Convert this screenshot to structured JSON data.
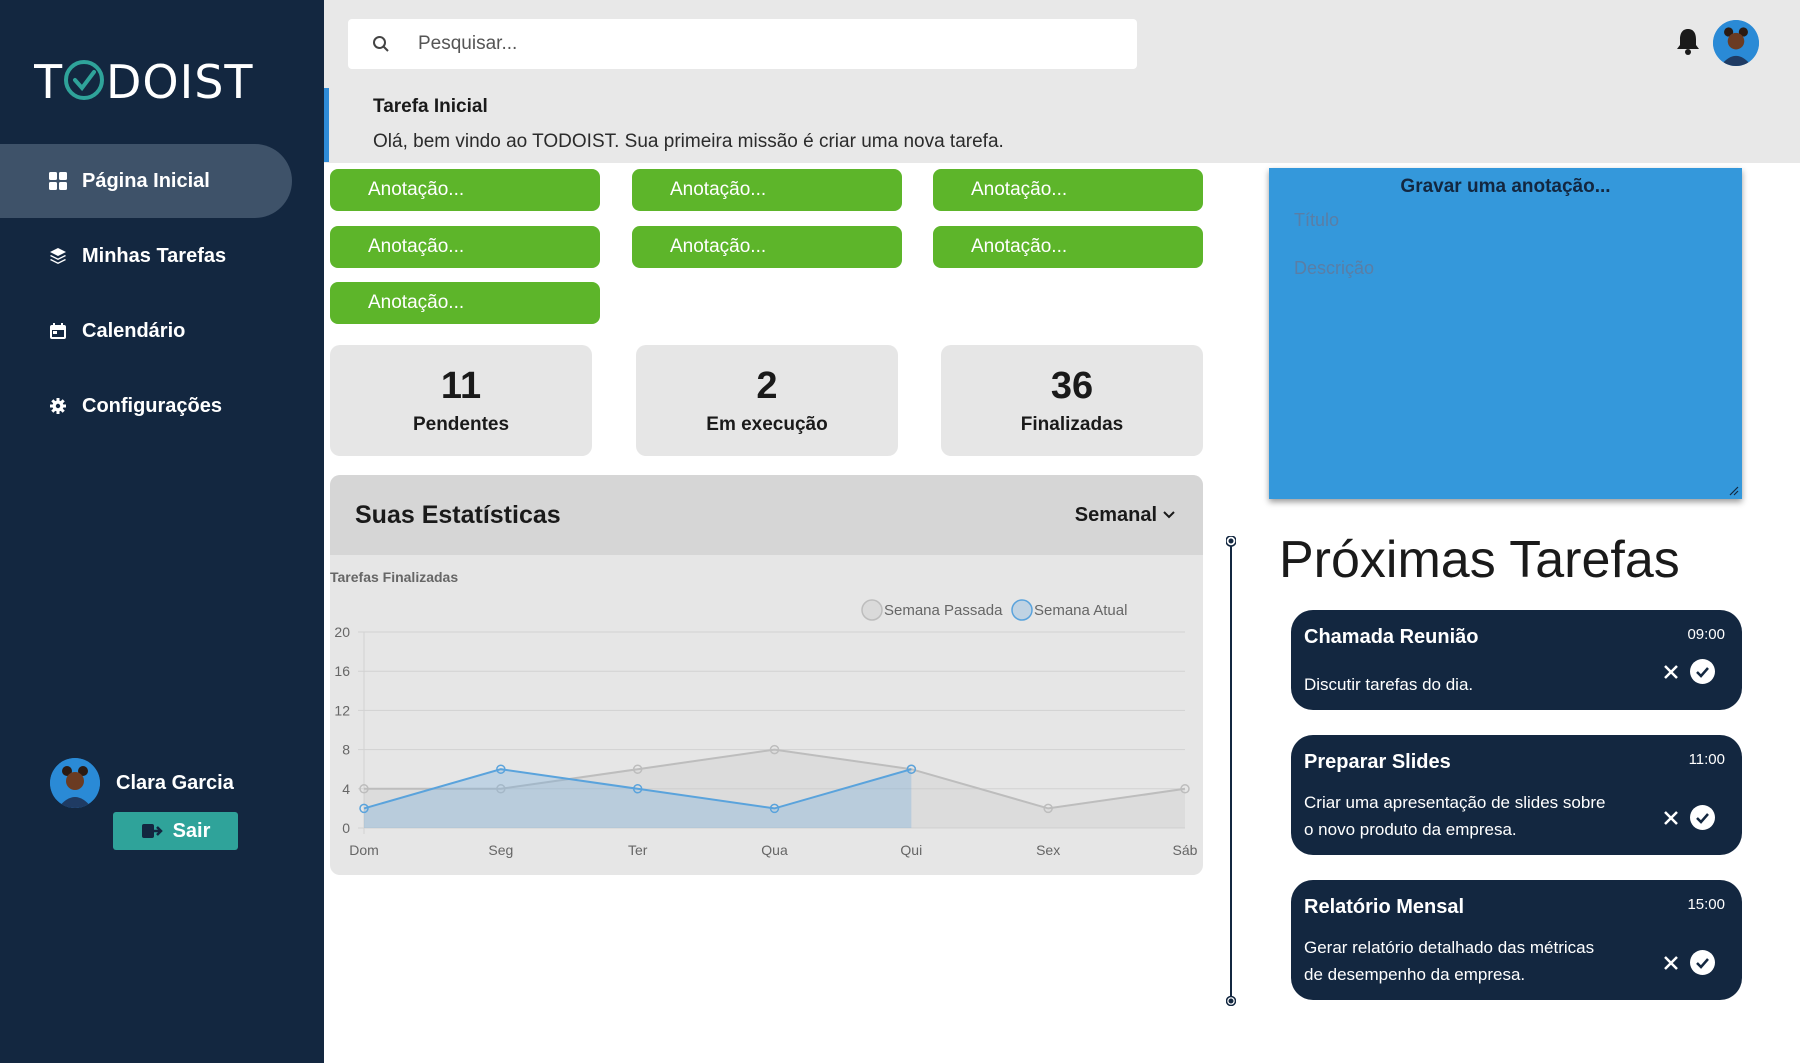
{
  "app": {
    "logo_text": "TODOIST"
  },
  "sidebar": {
    "items": [
      {
        "label": "Página Inicial",
        "icon": "grid-icon",
        "active": true
      },
      {
        "label": "Minhas Tarefas",
        "icon": "layers-icon",
        "active": false
      },
      {
        "label": "Calendário",
        "icon": "calendar-icon",
        "active": false
      },
      {
        "label": "Configurações",
        "icon": "gear-icon",
        "active": false
      }
    ],
    "user": {
      "name": "Clara Garcia"
    },
    "logout_label": "Sair"
  },
  "header": {
    "search_placeholder": "Pesquisar...",
    "welcome_title": "Tarefa Inicial",
    "welcome_message": "Olá, bem vindo ao TODOIST. Sua primeira missão é criar uma nova tarefa."
  },
  "notes": [
    "Anotação...",
    "Anotação...",
    "Anotação...",
    "Anotação...",
    "Anotação...",
    "Anotação...",
    "Anotação..."
  ],
  "stats": [
    {
      "value": "11",
      "label": "Pendentes"
    },
    {
      "value": "2",
      "label": "Em execução"
    },
    {
      "value": "36",
      "label": "Finalizadas"
    }
  ],
  "statistics": {
    "title": "Suas Estatísticas",
    "period": "Semanal"
  },
  "chart_data": {
    "type": "line",
    "title": "Tarefas Finalizadas",
    "categories": [
      "Dom",
      "Seg",
      "Ter",
      "Qua",
      "Qui",
      "Sex",
      "Sáb"
    ],
    "series": [
      {
        "name": "Semana Passada",
        "values": [
          4,
          4,
          6,
          8,
          6,
          2,
          4
        ],
        "color": "#bdbdbd"
      },
      {
        "name": "Semana Atual",
        "values": [
          2,
          6,
          4,
          2,
          6,
          null,
          null
        ],
        "color": "#5aa3dc"
      }
    ],
    "ylim": [
      0,
      20
    ],
    "yticks": [
      0,
      4,
      8,
      12,
      16,
      20
    ],
    "grid": true,
    "legend": "top-right"
  },
  "composer": {
    "title": "Gravar uma anotação...",
    "title_placeholder": "Título",
    "description_placeholder": "Descrição"
  },
  "upcoming": {
    "title": "Próximas Tarefas",
    "tasks": [
      {
        "title": "Chamada Reunião",
        "time": "09:00",
        "line1": "Discutir tarefas do dia.",
        "line2": ""
      },
      {
        "title": "Preparar Slides",
        "time": "11:00",
        "line1": "Criar uma apresentação de slides sobre",
        "line2": "o novo produto da empresa."
      },
      {
        "title": "Relatório Mensal",
        "time": "15:00",
        "line1": "Gerar relatório detalhado das métricas",
        "line2": "de desempenho da empresa."
      }
    ]
  },
  "colors": {
    "sidebar_bg": "#132740",
    "note_green": "#5db52a",
    "composer_blue": "#3498db",
    "accent_teal": "#2fa39a"
  }
}
